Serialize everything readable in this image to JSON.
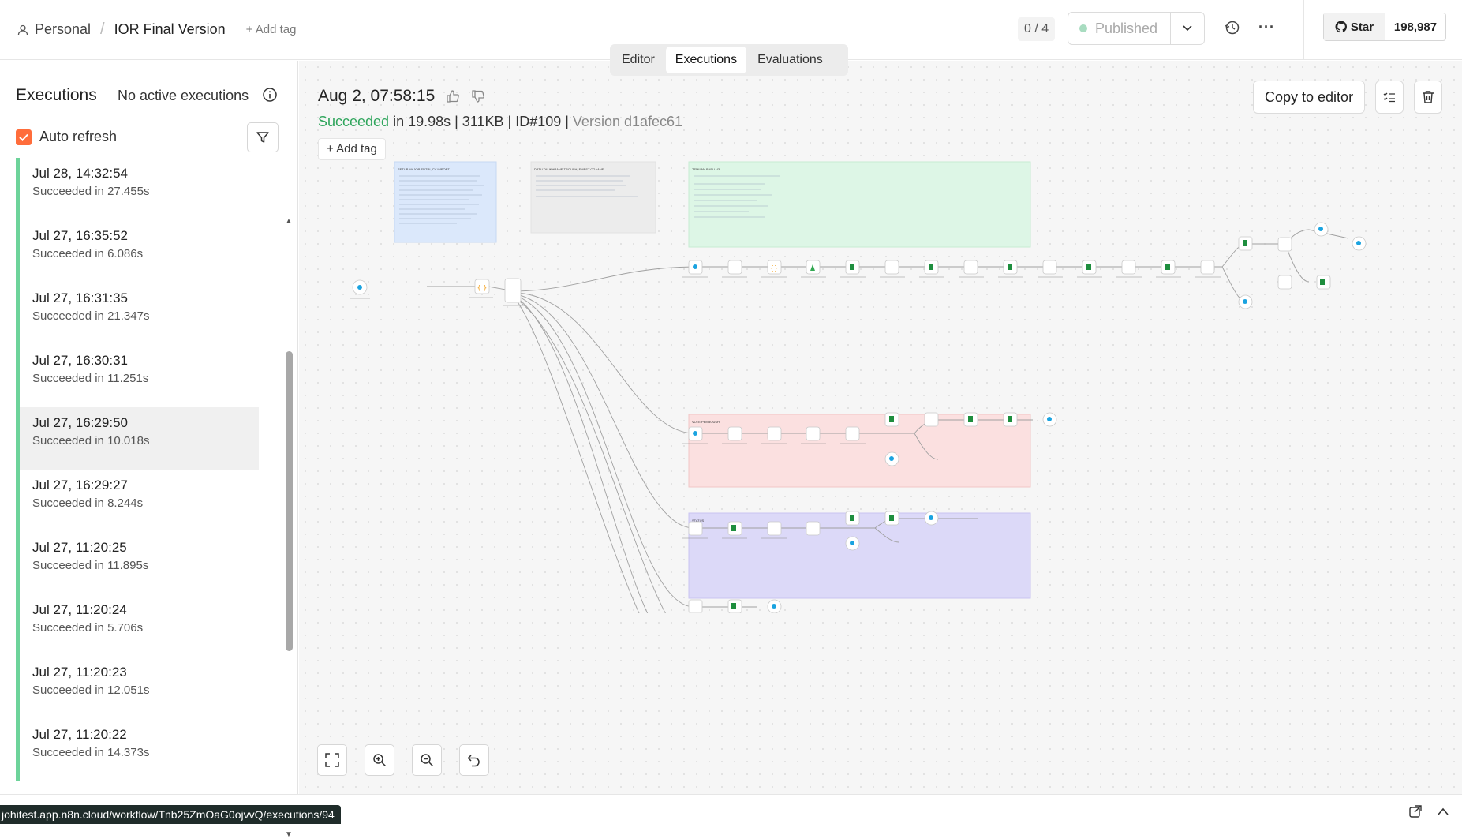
{
  "topbar": {
    "project": "Personal",
    "workflow_name": "IOR Final Version",
    "add_tag": "+ Add tag",
    "counter": "0 / 4",
    "published": "Published",
    "github_star": "Star",
    "github_count": "198,987"
  },
  "tabs": [
    {
      "label": "Editor"
    },
    {
      "label": "Executions"
    },
    {
      "label": "Evaluations"
    }
  ],
  "sidebar": {
    "title": "Executions",
    "no_active": "No active executions",
    "auto_refresh": "Auto refresh",
    "items": [
      {
        "date": "Jul 28, 14:32:54",
        "status": "Succeeded in 27.455s"
      },
      {
        "date": "Jul 27, 16:35:52",
        "status": "Succeeded in 6.086s"
      },
      {
        "date": "Jul 27, 16:31:35",
        "status": "Succeeded in 21.347s"
      },
      {
        "date": "Jul 27, 16:30:31",
        "status": "Succeeded in 11.251s"
      },
      {
        "date": "Jul 27, 16:29:50",
        "status": "Succeeded in 10.018s"
      },
      {
        "date": "Jul 27, 16:29:27",
        "status": "Succeeded in 8.244s"
      },
      {
        "date": "Jul 27, 11:20:25",
        "status": "Succeeded in 11.895s"
      },
      {
        "date": "Jul 27, 11:20:24",
        "status": "Succeeded in 5.706s"
      },
      {
        "date": "Jul 27, 11:20:23",
        "status": "Succeeded in 12.051s"
      },
      {
        "date": "Jul 27, 11:20:22",
        "status": "Succeeded in 14.373s"
      }
    ]
  },
  "execution": {
    "title": "Aug 2, 07:58:15",
    "status": "Succeeded",
    "meta_rest": " in 19.98s | 311KB | ID#109 | ",
    "version": "Version d1afec61",
    "add_tag": "Add tag",
    "copy_to_editor": "Copy to editor"
  },
  "workflow_groups": [
    {
      "label": "SETUP MAJOR ENTRI, CV IMPORT"
    },
    {
      "label": "DATU TALIKHRANE TROUSH, EMPST CGAANE"
    },
    {
      "label": "TEMUAN BARU V3"
    },
    {
      "label": "VOTE PEMBOUSH"
    },
    {
      "label": "STATUS"
    }
  ],
  "statusbar": {
    "url": "johitest.app.n8n.cloud/workflow/Tnb25ZmOaG0ojvvQ/executions/94"
  },
  "colors": {
    "accent": "#ff6d3b",
    "success": "#2fa55c",
    "success_bar": "#6dd39a",
    "group_blue": "#dbe8fb",
    "group_grey": "#ececec",
    "group_green": "#ddf6e6",
    "group_red": "#fbe0e0",
    "group_purple": "#dcd9f8"
  }
}
